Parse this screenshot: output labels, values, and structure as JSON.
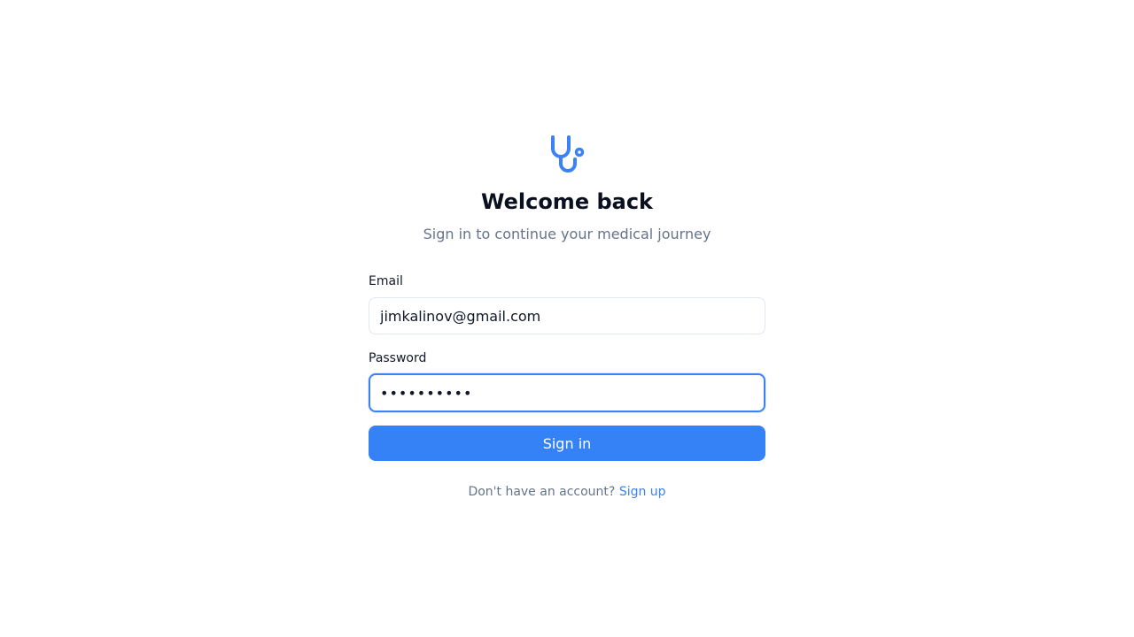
{
  "brand": {
    "icon": "stethoscope-icon",
    "accent_color": "#3b82f6"
  },
  "header": {
    "title": "Welcome back",
    "subtitle": "Sign in to continue your medical journey"
  },
  "form": {
    "email": {
      "label": "Email",
      "value": "jimkalinov@gmail.com"
    },
    "password": {
      "label": "Password",
      "value": "••••••••••"
    },
    "submit_label": "Sign in"
  },
  "footer": {
    "prompt": "Don't have an account?",
    "link_label": "Sign up"
  }
}
